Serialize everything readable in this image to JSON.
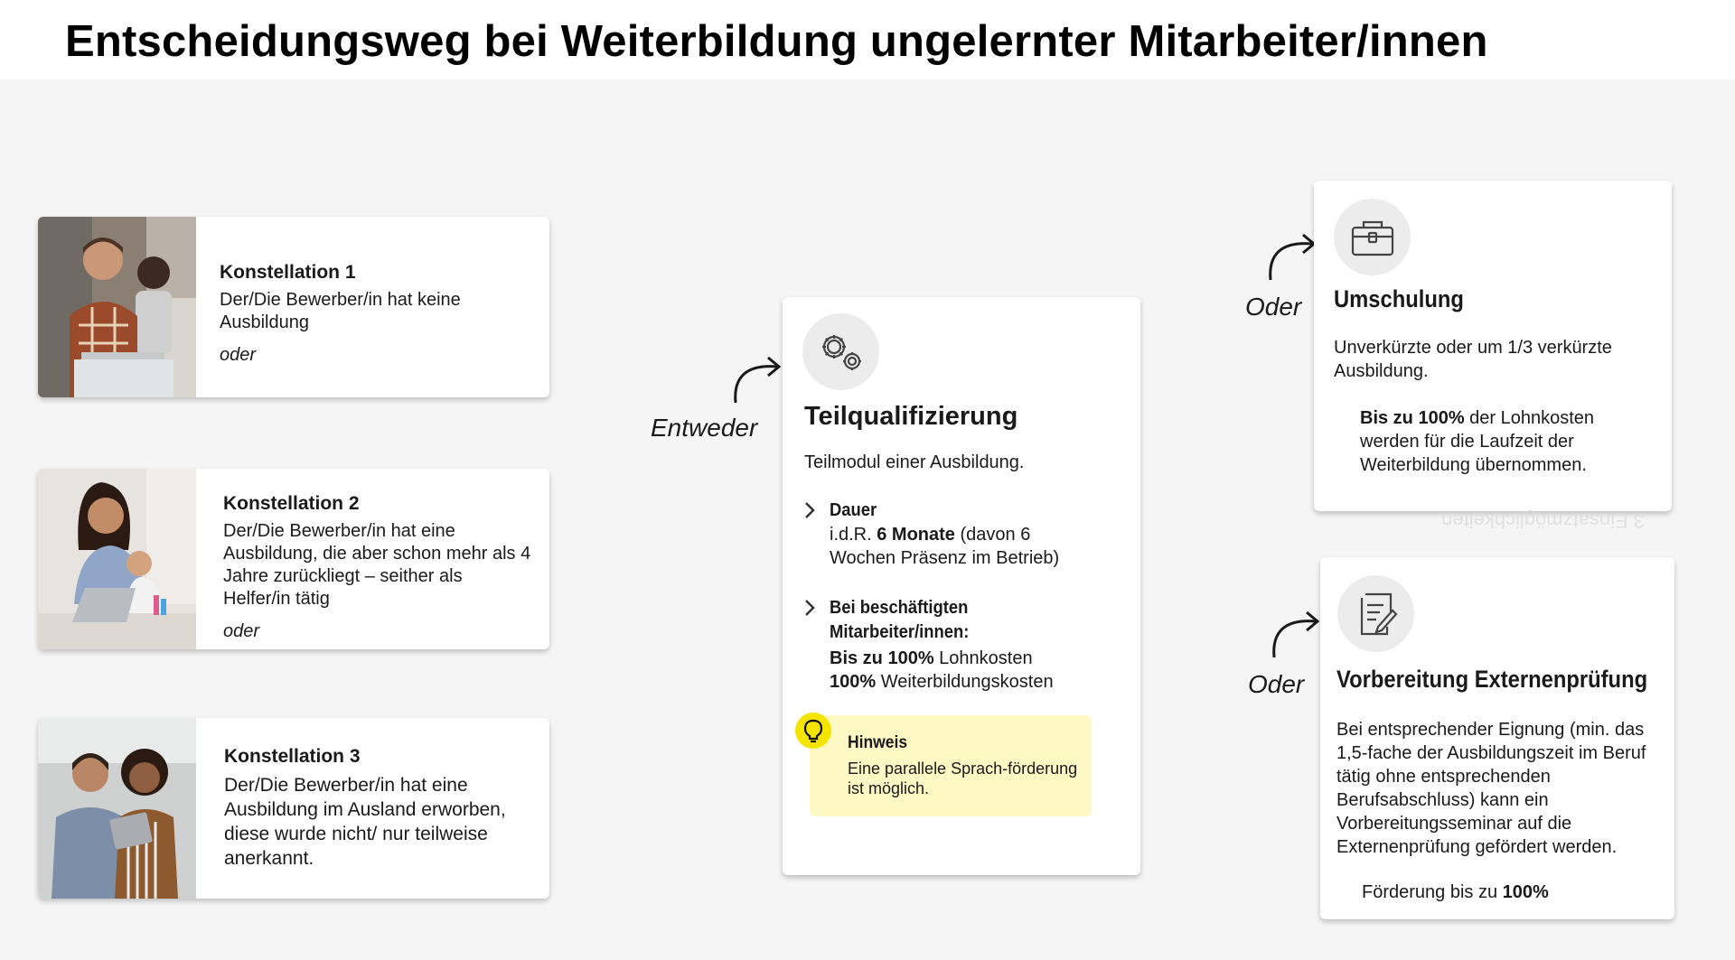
{
  "page": {
    "title": "Entscheidungsweg bei Weiterbildung ungelernter Mitarbeiter/innen"
  },
  "colors": {
    "hint_background": "#fdf8c4",
    "bulb": "#f5e400",
    "icon_circle": "#ececec"
  },
  "konstellationen": [
    {
      "title": "Konstellation 1",
      "description": "Der/Die Bewerber/in hat keine Ausbildung",
      "oder": "oder"
    },
    {
      "title": "Konstellation 2",
      "description": "Der/Die Bewerber/in hat eine Ausbildung, die aber schon mehr als 4 Jahre zurückliegt – seither als Helfer/in tätig",
      "oder": "oder"
    },
    {
      "title": "Konstellation 3",
      "description": "Der/Die Bewerber/in hat eine Ausbildung im Ausland erworben, diese wurde nicht/ nur teilweise anerkannt."
    }
  ],
  "connectors": {
    "entweder": "Entweder",
    "oder_1": "Oder",
    "oder_2": "Oder"
  },
  "teilqualifizierung": {
    "icon": "gears-icon",
    "title": "Teilqualifizierung",
    "subtitle": "Teilmodul einer Ausbildung.",
    "dauer": {
      "heading": "Dauer",
      "line1_pre": "i.d.R. ",
      "line1_bold": "6 Monate",
      "line1_post": " (davon 6",
      "line2": "Wochen Präsenz im Betrieb)"
    },
    "beschaeftigte": {
      "heading_1": "Bei beschäftigten",
      "heading_2": "Mitarbeiter/innen:",
      "line1_bold": "Bis zu 100%",
      "line1_rest": " Lohnkosten",
      "line2_bold": "100%",
      "line2_rest": " Weiterbildungskosten"
    },
    "hinweis": {
      "icon": "lightbulb-icon",
      "title": "Hinweis",
      "text": "Eine parallele Sprach-förderung ist möglich."
    }
  },
  "umschulung": {
    "icon": "briefcase-icon",
    "title": "Umschulung",
    "text": "Unverkürzte oder um 1/3 verkürzte Ausbildung.",
    "bold": "Bis zu 100%",
    "rest": " der Lohnkosten werden für die Laufzeit der Weiterbildung übernommen."
  },
  "externenpruefung": {
    "icon": "document-pen-icon",
    "title": "Vorbereitung Externenprüfung",
    "text": "Bei entsprechender Eignung (min. das 1,5-fache der Ausbildungszeit im Beruf tätig ohne entsprechenden Berufsabschluss) kann ein Vorbereitungsseminar auf die Externenprüfung gefördert werden.",
    "foerderung_pre": "Förderung bis zu ",
    "foerderung_bold": "100%"
  },
  "mirrored_text": "3 Einsatzmöglichkeiten"
}
